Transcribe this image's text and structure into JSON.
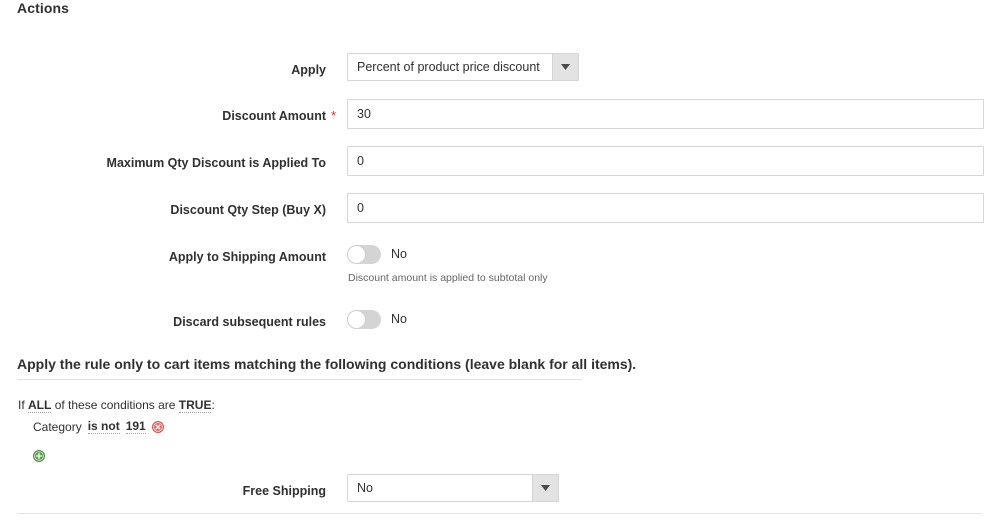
{
  "section": {
    "title": "Actions"
  },
  "fields": {
    "apply": {
      "label": "Apply",
      "value": "Percent of product price discount",
      "arrow_icon": "chevron-down-icon"
    },
    "discount_amount": {
      "label": "Discount Amount",
      "required_marker": "*",
      "value": "30",
      "placeholder": ""
    },
    "max_qty": {
      "label": "Maximum Qty Discount is Applied To",
      "value": "0",
      "placeholder": ""
    },
    "qty_step": {
      "label": "Discount Qty Step (Buy X)",
      "value": "0",
      "placeholder": ""
    },
    "apply_to_shipping": {
      "label": "Apply to Shipping Amount",
      "state_text": "No",
      "note": "Discount amount is applied to subtotal only"
    },
    "discard_subsequent": {
      "label": "Discard subsequent rules",
      "state_text": "No"
    },
    "free_shipping": {
      "label": "Free Shipping",
      "value": "No",
      "arrow_icon": "chevron-down-icon"
    }
  },
  "conditions": {
    "title": "Apply the rule only to cart items matching the following conditions (leave blank for all items).",
    "intro": {
      "prefix": "If",
      "aggregator": "ALL",
      "middle": "of these conditions are",
      "value": "TRUE",
      "suffix": ":"
    },
    "rows": [
      {
        "subject": "Category",
        "operator": "is not",
        "value": "191",
        "remove_icon": "remove-circle-icon"
      }
    ],
    "add_icon": "add-circle-icon"
  },
  "colors": {
    "required_red": "#e02b27",
    "remove_red": "#e05c5c",
    "add_green": "#4b8b3b",
    "text": "#303030",
    "border": "#d6d6d6",
    "select_button": "#e3e3e3"
  }
}
